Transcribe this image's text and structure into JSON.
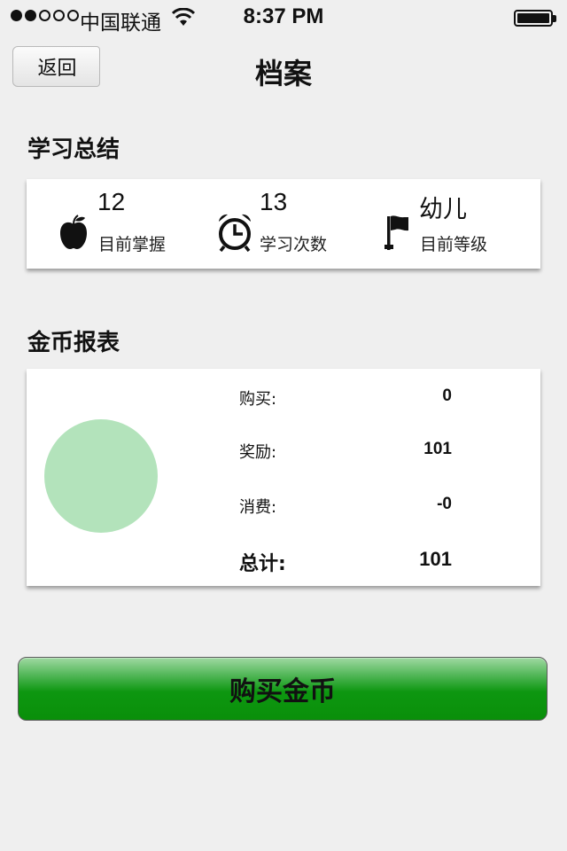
{
  "status_bar": {
    "carrier": "中国联通",
    "time": "8:37 PM",
    "signal_bars": 2,
    "signal_total": 5
  },
  "nav": {
    "back_label": "返回",
    "title": "档案"
  },
  "study_summary": {
    "title": "学习总结",
    "stats": [
      {
        "value": "12",
        "label": "目前掌握",
        "icon": "apple-icon"
      },
      {
        "value": "13",
        "label": "学习次数",
        "icon": "alarm-clock-icon"
      },
      {
        "value": "幼儿",
        "label": "目前等级",
        "icon": "flag-icon"
      }
    ]
  },
  "coin_report": {
    "title": "金币报表",
    "rows": [
      {
        "label": "购买:",
        "value": "0"
      },
      {
        "label": "奖励:",
        "value": "101"
      },
      {
        "label": "消费:",
        "value": "-0"
      }
    ],
    "total": {
      "label": "总计:",
      "value": "101"
    },
    "pie_color": "#b3e3bb"
  },
  "buy_button": {
    "label": "购买金币",
    "color": "#0d9710"
  }
}
